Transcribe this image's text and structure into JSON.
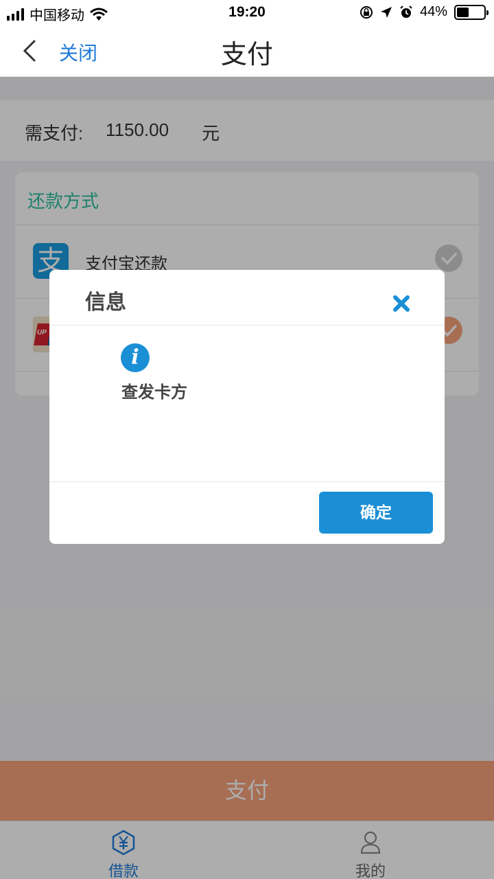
{
  "status_bar": {
    "carrier": "中国移动",
    "time": "19:20",
    "battery_percent_text": "44%",
    "battery_level": 0.44
  },
  "nav": {
    "close_label": "关闭",
    "title": "支付"
  },
  "payment": {
    "amount_label": "需支付:",
    "amount_value": "1150.00",
    "currency": "元"
  },
  "methods_card": {
    "title": "还款方式",
    "options": [
      {
        "label": "支付宝还款",
        "logo": "alipay-logo",
        "logo_glyph": "支",
        "selected": false
      },
      {
        "label": "",
        "logo": "unionpay-logo",
        "logo_text": "UP",
        "selected": true
      }
    ]
  },
  "pay_button_label": "支付",
  "tabs": [
    {
      "label": "借款",
      "icon": "yuan-hexagon-icon",
      "active": true
    },
    {
      "label": "我的",
      "icon": "person-icon",
      "active": false
    }
  ],
  "dialog": {
    "title": "信息",
    "message": "查发卡方",
    "confirm_label": "确定"
  },
  "colors": {
    "accent_blue": "#1a8fd6",
    "link_blue": "#1f7bd9",
    "teal_title": "#2bbfa0",
    "pay_button": "#f7a27c",
    "selected_radio": "#f7a27c",
    "unselected_radio": "#cfcfcf",
    "overlay": "rgba(0,0,0,0.32)"
  }
}
